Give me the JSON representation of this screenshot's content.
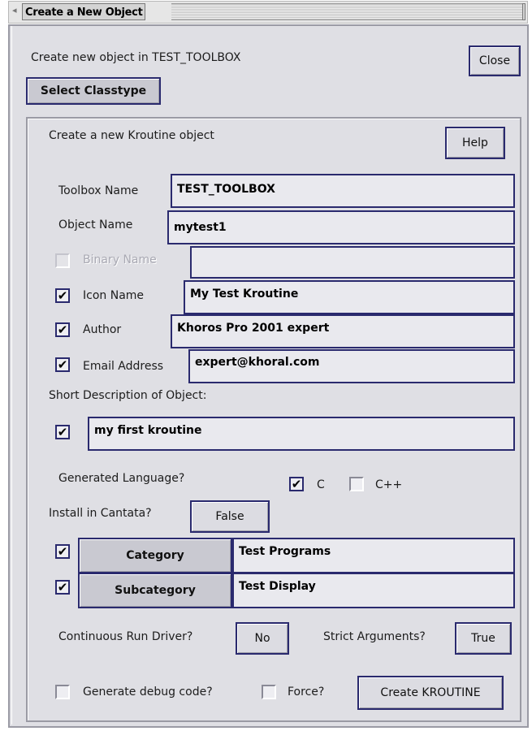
{
  "titlebar": {
    "title": "Create a New Object",
    "arrow": "◂"
  },
  "header": {
    "create_in": "Create new object in TEST_TOOLBOX",
    "close": "Close",
    "select_classtype": "Select Classtype"
  },
  "panel": {
    "heading": "Create a new Kroutine object",
    "help": "Help",
    "toolbox_name": {
      "label": "Toolbox Name",
      "value": "TEST_TOOLBOX"
    },
    "object_name": {
      "label": "Object Name",
      "value": "mytest1"
    },
    "binary_name": {
      "label": "Binary Name",
      "value": "",
      "checked": false
    },
    "icon_name": {
      "label": "Icon Name",
      "value": "My Test Kroutine",
      "checked": true
    },
    "author": {
      "label": "Author",
      "value": "Khoros Pro 2001 expert",
      "checked": true
    },
    "email": {
      "label": "Email Address",
      "value": "expert@khoral.com",
      "checked": true
    },
    "short_desc": {
      "label": "Short Description of Object:",
      "value": "my first kroutine",
      "checked": true
    },
    "language": {
      "label": "Generated Language?",
      "c": "C",
      "c_checked": true,
      "cpp": "C++",
      "cpp_checked": false
    },
    "install": {
      "label": "Install in Cantata?",
      "value": "False"
    },
    "category": {
      "button": "Category",
      "value": "Test Programs",
      "checked": true
    },
    "subcategory": {
      "button": "Subcategory",
      "value": "Test Display",
      "checked": true
    },
    "continuous": {
      "label": "Continuous Run Driver?",
      "value": "No"
    },
    "strict": {
      "label": "Strict Arguments?",
      "value": "True"
    },
    "debug": {
      "label": "Generate debug code?",
      "checked": false
    },
    "force": {
      "label": "Force?",
      "checked": false
    },
    "create": "Create KROUTINE"
  },
  "check_glyph": "✔",
  "icons": {
    "title_arrow": "triangle-left-icon",
    "checkmark": "checkmark-icon"
  }
}
